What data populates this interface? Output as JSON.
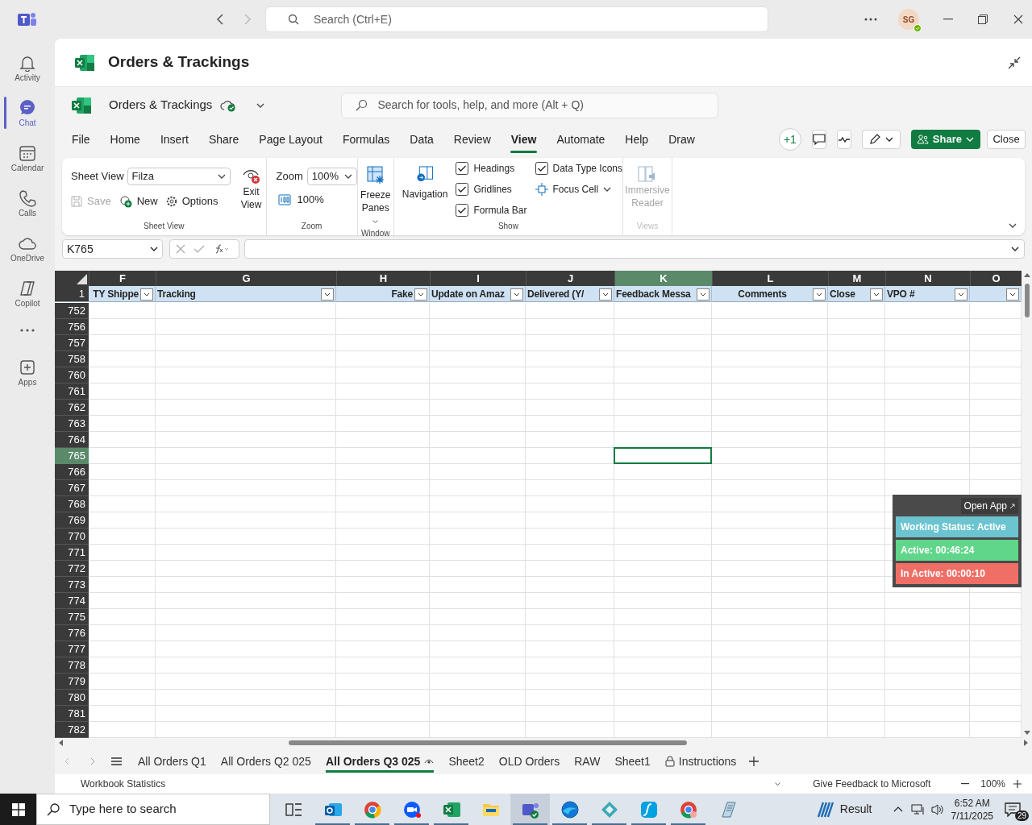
{
  "app_bar": {
    "search_placeholder": "Search (Ctrl+E)",
    "avatar": "SG"
  },
  "rail": [
    {
      "label": "Activity",
      "kind": "bell",
      "selected": false
    },
    {
      "label": "Chat",
      "kind": "chat",
      "selected": true
    },
    {
      "label": "Calendar",
      "kind": "calendar",
      "selected": false
    },
    {
      "label": "Calls",
      "kind": "phone",
      "selected": false
    },
    {
      "label": "OneDrive",
      "kind": "cloud",
      "selected": false
    },
    {
      "label": "Copilot",
      "kind": "copilot",
      "selected": false
    },
    {
      "label": "Apps",
      "kind": "plus",
      "selected": false
    }
  ],
  "window": {
    "title": "Orders & Trackings"
  },
  "workbook": {
    "name": "Orders & Trackings",
    "search_placeholder": "Search for tools, help, and more (Alt + Q)"
  },
  "ribbon_tabs": [
    {
      "label": "File",
      "selected": false
    },
    {
      "label": "Home",
      "selected": false
    },
    {
      "label": "Insert",
      "selected": false
    },
    {
      "label": "Share",
      "selected": false
    },
    {
      "label": "Page Layout",
      "selected": false
    },
    {
      "label": "Formulas",
      "selected": false
    },
    {
      "label": "Data",
      "selected": false
    },
    {
      "label": "Review",
      "selected": false
    },
    {
      "label": "View",
      "selected": true
    },
    {
      "label": "Automate",
      "selected": false
    },
    {
      "label": "Help",
      "selected": false
    },
    {
      "label": "Draw",
      "selected": false
    }
  ],
  "toolbar": {
    "presence": "+1",
    "share": "Share",
    "close": "Close"
  },
  "ribbon": {
    "sheet_view": {
      "label": "Sheet View",
      "value": "Filza",
      "save": "Save",
      "save_disabled": true,
      "new": "New",
      "options": "Options",
      "exit": "Exit View",
      "group": "Sheet View"
    },
    "zoom": {
      "label": "Zoom",
      "value": "100%",
      "reset": "100%",
      "group": "Zoom"
    },
    "window": {
      "freeze": "Freeze Panes",
      "group": "Window"
    },
    "show": {
      "navigation": "Navigation",
      "checks": [
        {
          "label": "Headings",
          "checked": true
        },
        {
          "label": "Gridlines",
          "checked": true
        },
        {
          "label": "Formula Bar",
          "checked": true
        },
        {
          "label": "Data Type Icons",
          "checked": true
        }
      ],
      "focus_cell": "Focus Cell",
      "group": "Show"
    },
    "views": {
      "reader": "Immersive Reader",
      "disabled": true,
      "group": "Views"
    }
  },
  "formula_bar": {
    "name_box": "K765"
  },
  "grid": {
    "columns": [
      {
        "letter": "F",
        "header": "TY Shippe",
        "selected": false
      },
      {
        "letter": "G",
        "header": "Tracking",
        "selected": false
      },
      {
        "letter": "H",
        "header": "Fake",
        "selected": false
      },
      {
        "letter": "I",
        "header": "Update on Amaz",
        "selected": false
      },
      {
        "letter": "J",
        "header": "Delivered (Y/",
        "selected": false
      },
      {
        "letter": "K",
        "header": "Feedback Messa",
        "selected": true
      },
      {
        "letter": "L",
        "header": "Comments",
        "selected": false
      },
      {
        "letter": "M",
        "header": "Close",
        "selected": false
      },
      {
        "letter": "N",
        "header": "VPO #",
        "selected": false
      },
      {
        "letter": "O",
        "selected": false
      }
    ],
    "header_row": "1",
    "rows": [
      {
        "number": "752",
        "selected": false
      },
      {
        "number": "756",
        "selected": false
      },
      {
        "number": "757",
        "selected": false
      },
      {
        "number": "758",
        "selected": false
      },
      {
        "number": "760",
        "selected": false
      },
      {
        "number": "761",
        "selected": false
      },
      {
        "number": "762",
        "selected": false
      },
      {
        "number": "763",
        "selected": false
      },
      {
        "number": "764",
        "selected": false
      },
      {
        "number": "765",
        "selected": true
      },
      {
        "number": "766",
        "selected": false
      },
      {
        "number": "767",
        "selected": false
      },
      {
        "number": "768",
        "selected": false
      },
      {
        "number": "769",
        "selected": false
      },
      {
        "number": "770",
        "selected": false
      },
      {
        "number": "771",
        "selected": false
      },
      {
        "number": "772",
        "selected": false
      },
      {
        "number": "773",
        "selected": false
      },
      {
        "number": "774",
        "selected": false
      },
      {
        "number": "775",
        "selected": false
      },
      {
        "number": "776",
        "selected": false
      },
      {
        "number": "777",
        "selected": false
      },
      {
        "number": "778",
        "selected": false
      },
      {
        "number": "779",
        "selected": false
      },
      {
        "number": "780",
        "selected": false
      },
      {
        "number": "781",
        "selected": false
      },
      {
        "number": "782",
        "selected": false
      }
    ]
  },
  "widget": {
    "open_app": "Open App",
    "lines": [
      {
        "text": "Working Status: Active",
        "color": "#6cc4d0"
      },
      {
        "text": "Active: 00:46:24",
        "color": "#5fd68a"
      },
      {
        "text": "In Active: 00:00:10",
        "color": "#ef6f67"
      }
    ]
  },
  "sheet_tabs": [
    {
      "label": "All Orders Q1",
      "kind": "plain",
      "selected": false
    },
    {
      "label": "All Orders Q2 025",
      "kind": "plain",
      "selected": false
    },
    {
      "label": "All Orders Q3 025",
      "kind": "viewed",
      "selected": true
    },
    {
      "label": "Sheet2",
      "kind": "plain",
      "selected": false
    },
    {
      "label": "OLD Orders",
      "kind": "plain",
      "selected": false
    },
    {
      "label": "RAW",
      "kind": "plain",
      "selected": false
    },
    {
      "label": "Sheet1",
      "kind": "plain",
      "selected": false
    },
    {
      "label": "Instructions",
      "kind": "locked",
      "selected": false
    }
  ],
  "status_bar": {
    "left": "Workbook Statistics",
    "feedback": "Give Feedback to Microsoft",
    "zoom": "100%"
  },
  "taskbar": {
    "search_placeholder": "Type here to search",
    "weather": "Result",
    "time": "6:52 AM",
    "date": "7/11/2025",
    "notifications": "29",
    "apps": [
      {
        "kind": "taskview",
        "running": false,
        "selected": false
      },
      {
        "kind": "mail",
        "running": true,
        "selected": false
      },
      {
        "kind": "browser",
        "running": true,
        "selected": false
      },
      {
        "kind": "video",
        "running": true,
        "selected": false
      },
      {
        "kind": "sheet",
        "running": true,
        "selected": false
      },
      {
        "kind": "folder",
        "running": false,
        "selected": false
      },
      {
        "kind": "team",
        "running": true,
        "selected": true
      },
      {
        "kind": "wave",
        "running": true,
        "selected": false
      },
      {
        "kind": "diamond",
        "running": true,
        "selected": false
      },
      {
        "kind": "script",
        "running": true,
        "selected": false
      },
      {
        "kind": "browser2",
        "running": true,
        "selected": false
      },
      {
        "kind": "notes",
        "running": false,
        "selected": false
      }
    ]
  }
}
